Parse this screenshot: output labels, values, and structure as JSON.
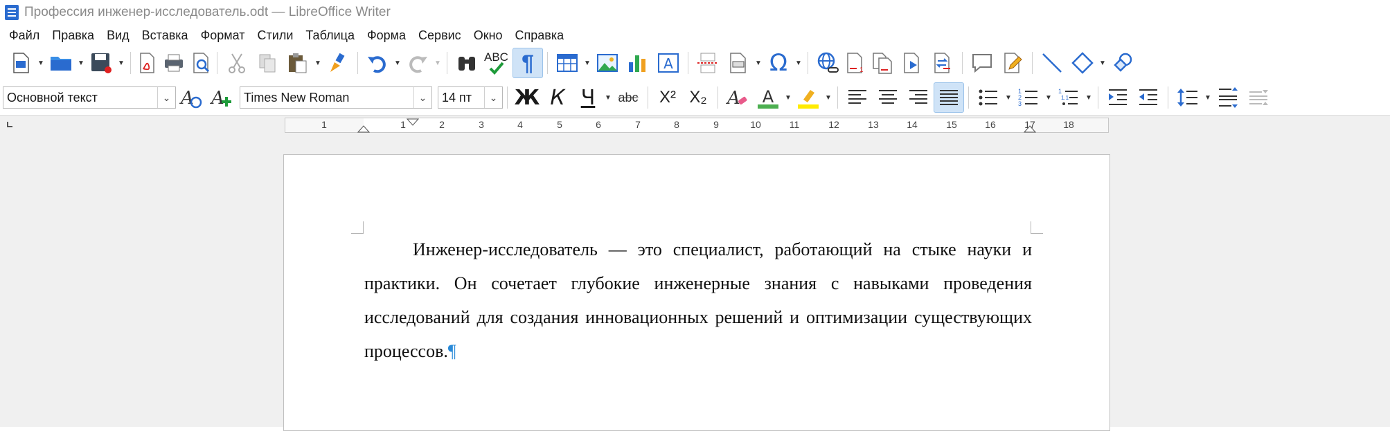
{
  "window": {
    "title": "Профессия инженер-исследователь.odt — LibreOffice Writer"
  },
  "menu": [
    "Файл",
    "Правка",
    "Вид",
    "Вставка",
    "Формат",
    "Стили",
    "Таблица",
    "Форма",
    "Сервис",
    "Окно",
    "Справка"
  ],
  "formatting": {
    "paragraph_style": "Основной текст",
    "font_name": "Times New Roman",
    "font_size": "14 пт",
    "bold_glyph": "Ж",
    "italic_glyph": "К",
    "underline_glyph": "Ч",
    "strike_glyph": "abc",
    "superscript_glyph": "X²",
    "subscript_glyph": "X₂",
    "special_char_glyph": "Ω",
    "spellcheck_glyph": "ABC",
    "formatting_marks_glyph": "¶"
  },
  "ruler": {
    "labels": [
      "1",
      "1",
      "2",
      "3",
      "4",
      "5",
      "6",
      "7",
      "8",
      "9",
      "10",
      "11",
      "12",
      "13",
      "14",
      "15",
      "16",
      "17",
      "18"
    ]
  },
  "document": {
    "paragraph": "Инженер-исследователь — это специалист, работающий на стыке науки и практики. Он сочетает глубокие инженерные знания с навыками проведения исследований для создания инновационных решений и оптимизации существующих процессов.",
    "pilcrow": "¶"
  },
  "colors": {
    "accent": "#2a6bcf",
    "active_button_bg": "#cfe3f7",
    "workspace_bg": "#f0f0f0",
    "font_color_bar": "#4caf50",
    "highlight_bar": "#ffeb00"
  }
}
